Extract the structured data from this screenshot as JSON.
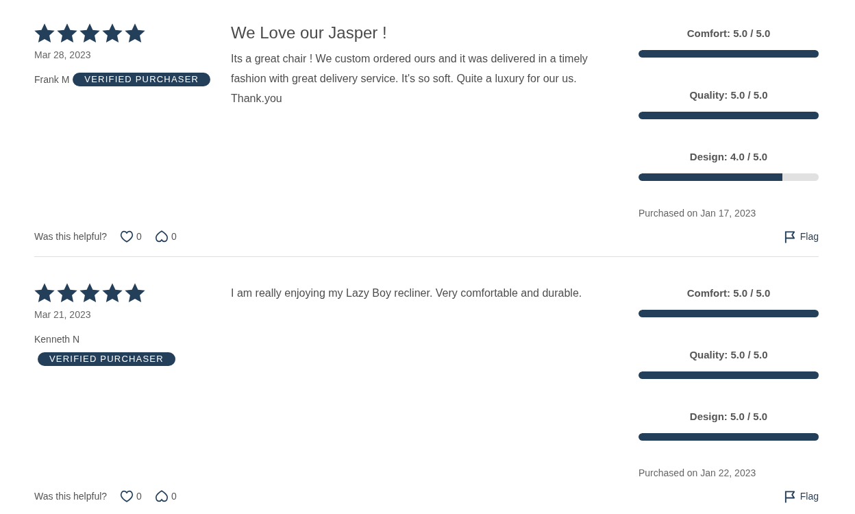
{
  "reviews": [
    {
      "stars": 5,
      "date": "Mar 28, 2023",
      "author": "Frank M",
      "badge": "VERIFIED PURCHASER",
      "title": "We Love our Jasper !",
      "body": "Its a great chair ! We custom ordered ours and it was delivered in a timely fashion with great delivery service. It's so soft. Quite a luxury for our us. Thank.you",
      "ratings": [
        {
          "label": "Comfort: 5.0 / 5.0",
          "level": 1
        },
        {
          "label": "Quality: 5.0 / 5.0",
          "level": 1
        },
        {
          "label": "Design: 4.0 / 5.0",
          "level": 0.8
        }
      ],
      "purchased": "Purchased on Jan 17, 2023",
      "helpful_prompt": "Was this helpful?",
      "helpful_count": "0",
      "not_helpful_count": "0",
      "flag": "Flag"
    },
    {
      "stars": 5,
      "date": "Mar 21, 2023",
      "author": "Kenneth N",
      "badge": "VERIFIED PURCHASER",
      "body": "I am really enjoying my Lazy Boy recliner. Very comfortable and durable.",
      "ratings": [
        {
          "label": "Comfort: 5.0 / 5.0",
          "level": 1
        },
        {
          "label": "Quality: 5.0 / 5.0",
          "level": 1
        },
        {
          "label": "Design: 5.0 / 5.0",
          "level": 1
        }
      ],
      "purchased": "Purchased on Jan 22, 2023",
      "helpful_prompt": "Was this helpful?",
      "helpful_count": "0",
      "not_helpful_count": "0",
      "flag": "Flag"
    }
  ]
}
